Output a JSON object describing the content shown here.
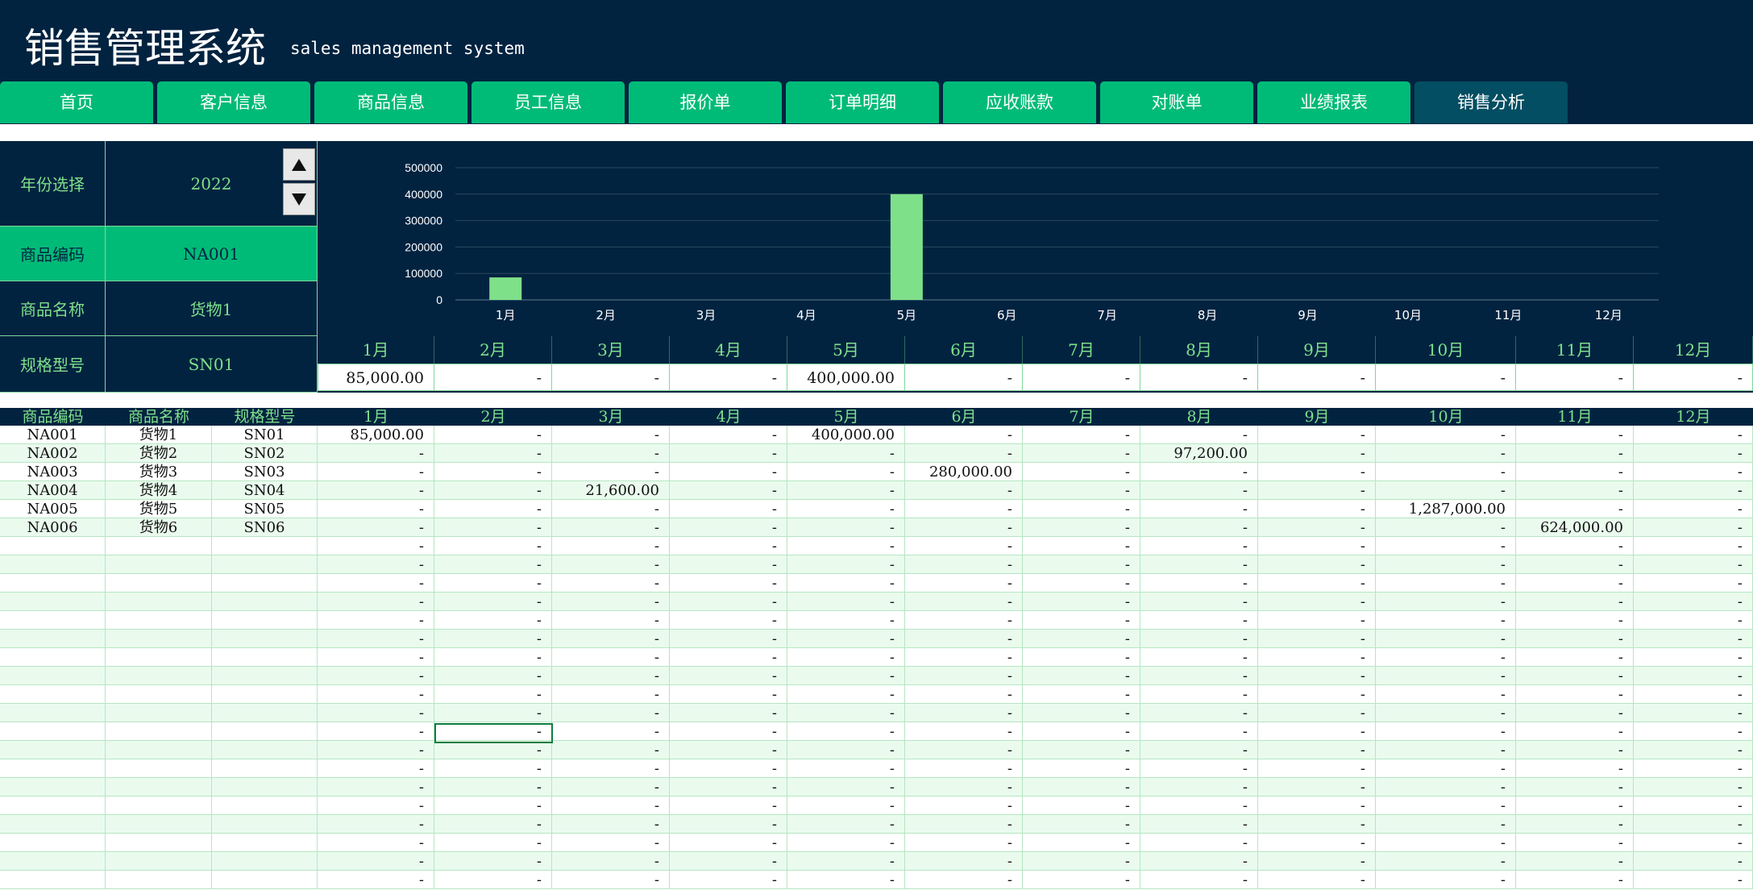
{
  "app": {
    "title": "销售管理系统",
    "subtitle": "sales management system"
  },
  "nav": {
    "tabs": [
      "首页",
      "客户信息",
      "商品信息",
      "员工信息",
      "报价单",
      "订单明细",
      "应收账款",
      "对账单",
      "业绩报表",
      "销售分析"
    ],
    "active": 9
  },
  "selector": {
    "year_label": "年份选择",
    "year_value": "2022",
    "code_label": "商品编码",
    "code_value": "NA001",
    "name_label": "商品名称",
    "name_value": "货物1",
    "spec_label": "规格型号",
    "spec_value": "SN01"
  },
  "months": [
    "1月",
    "2月",
    "3月",
    "4月",
    "5月",
    "6月",
    "7月",
    "8月",
    "9月",
    "10月",
    "11月",
    "12月"
  ],
  "selected_values": [
    "85,000.00",
    "-",
    "-",
    "-",
    "400,000.00",
    "-",
    "-",
    "-",
    "-",
    "-",
    "-",
    "-"
  ],
  "chart_data": {
    "type": "bar",
    "categories": [
      "1月",
      "2月",
      "3月",
      "4月",
      "5月",
      "6月",
      "7月",
      "8月",
      "9月",
      "10月",
      "11月",
      "12月"
    ],
    "values": [
      85000,
      0,
      0,
      0,
      400000,
      0,
      0,
      0,
      0,
      0,
      0,
      0
    ],
    "ylim": [
      0,
      500000
    ],
    "yticks": [
      "0",
      "100000",
      "200000",
      "300000",
      "400000",
      "500000"
    ],
    "grid": true,
    "legend": "none",
    "bar_color": "#7FE08A"
  },
  "table": {
    "headers": [
      "商品编码",
      "商品名称",
      "规格型号",
      "1月",
      "2月",
      "3月",
      "4月",
      "5月",
      "6月",
      "7月",
      "8月",
      "9月",
      "10月",
      "11月",
      "12月"
    ],
    "rows": [
      {
        "code": "NA001",
        "name": "货物1",
        "spec": "SN01",
        "vals": [
          "85,000.00",
          "-",
          "-",
          "-",
          "400,000.00",
          "-",
          "-",
          "-",
          "-",
          "-",
          "-",
          "-"
        ]
      },
      {
        "code": "NA002",
        "name": "货物2",
        "spec": "SN02",
        "vals": [
          "-",
          "-",
          "-",
          "-",
          "-",
          "-",
          "-",
          "97,200.00",
          "-",
          "-",
          "-",
          "-"
        ]
      },
      {
        "code": "NA003",
        "name": "货物3",
        "spec": "SN03",
        "vals": [
          "-",
          "-",
          "-",
          "-",
          "-",
          "280,000.00",
          "-",
          "-",
          "-",
          "-",
          "-",
          "-"
        ]
      },
      {
        "code": "NA004",
        "name": "货物4",
        "spec": "SN04",
        "vals": [
          "-",
          "-",
          "21,600.00",
          "-",
          "-",
          "-",
          "-",
          "-",
          "-",
          "-",
          "-",
          "-"
        ]
      },
      {
        "code": "NA005",
        "name": "货物5",
        "spec": "SN05",
        "vals": [
          "-",
          "-",
          "-",
          "-",
          "-",
          "-",
          "-",
          "-",
          "-",
          "1,287,000.00",
          "-",
          "-"
        ]
      },
      {
        "code": "NA006",
        "name": "货物6",
        "spec": "SN06",
        "vals": [
          "-",
          "-",
          "-",
          "-",
          "-",
          "-",
          "-",
          "-",
          "-",
          "-",
          "624,000.00",
          "-"
        ]
      }
    ],
    "empty_rows": 19,
    "empty_value": "-"
  },
  "colors": {
    "navy": "#012340",
    "tab_green": "#00BB78",
    "tab_active": "#034E62",
    "label_green": "#7FE08A",
    "alt_row": "#EAFBEE"
  }
}
